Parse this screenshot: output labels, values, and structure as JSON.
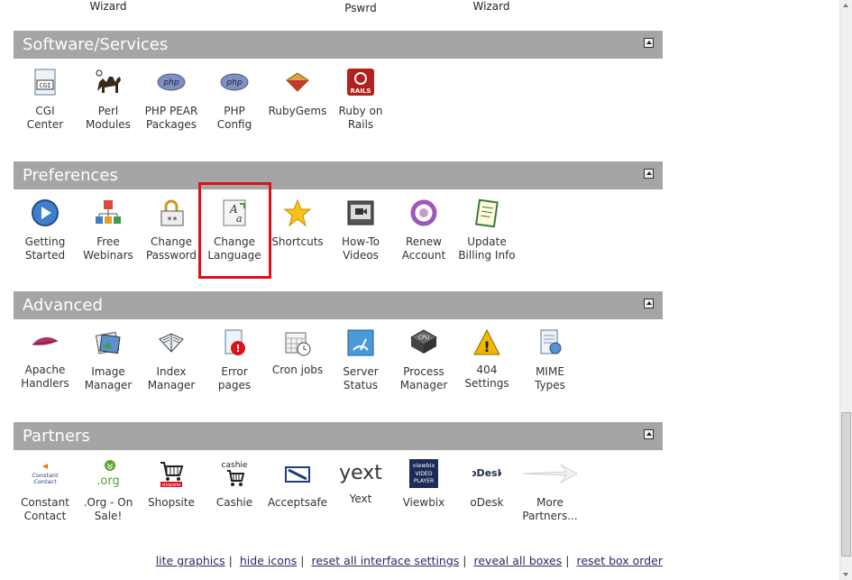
{
  "top_row": [
    "Wizard",
    "Pswrd",
    "Wizard"
  ],
  "sections": {
    "software": {
      "title": "Software/Services",
      "items": [
        {
          "label": "CGI\nCenter",
          "icon": "cgi-icon"
        },
        {
          "label": "Perl\nModules",
          "icon": "camel-icon"
        },
        {
          "label": "PHP PEAR\nPackages",
          "icon": "php-icon"
        },
        {
          "label": "PHP\nConfig",
          "icon": "php-icon"
        },
        {
          "label": "RubyGems",
          "icon": "ruby-gem-icon"
        },
        {
          "label": "Ruby on\nRails",
          "icon": "rails-icon"
        }
      ]
    },
    "preferences": {
      "title": "Preferences",
      "items": [
        {
          "label": "Getting\nStarted",
          "icon": "play-icon"
        },
        {
          "label": "Free\nWebinars",
          "icon": "webinar-icon"
        },
        {
          "label": "Change\nPassword",
          "icon": "password-lock-icon"
        },
        {
          "label": "Change\nLanguage",
          "icon": "language-icon"
        },
        {
          "label": "Shortcuts",
          "icon": "star-icon"
        },
        {
          "label": "How-To\nVideos",
          "icon": "video-icon"
        },
        {
          "label": "Renew\nAccount",
          "icon": "renew-icon"
        },
        {
          "label": "Update\nBilling Info",
          "icon": "billing-icon"
        }
      ]
    },
    "advanced": {
      "title": "Advanced",
      "items": [
        {
          "label": "Apache\nHandlers",
          "icon": "apache-feather-icon"
        },
        {
          "label": "Image\nManager",
          "icon": "image-icon"
        },
        {
          "label": "Index\nManager",
          "icon": "index-book-icon"
        },
        {
          "label": "Error\npages",
          "icon": "error-page-icon"
        },
        {
          "label": "Cron jobs",
          "icon": "calendar-clock-icon"
        },
        {
          "label": "Server\nStatus",
          "icon": "server-status-icon"
        },
        {
          "label": "Process\nManager",
          "icon": "cpu-icon"
        },
        {
          "label": "404\nSettings",
          "icon": "warning-icon"
        },
        {
          "label": "MIME\nTypes",
          "icon": "mime-icon"
        }
      ]
    },
    "partners": {
      "title": "Partners",
      "items": [
        {
          "label": "Constant\nContact",
          "icon": "constant-contact-logo-icon",
          "logo_text": "Constant Contact"
        },
        {
          "label": ".Org - On\nSale!",
          "icon": "org-logo-icon",
          "logo_text": ".org"
        },
        {
          "label": "Shopsite",
          "icon": "shopsite-cart-icon",
          "logo_text": "shopsite"
        },
        {
          "label": "Cashie",
          "icon": "cashie-cart-icon",
          "logo_text": "cashie"
        },
        {
          "label": "Acceptsafe",
          "icon": "acceptsafe-card-icon"
        },
        {
          "label": "Yext",
          "icon": "yext-logo-icon",
          "logo_text": "yext"
        },
        {
          "label": "Viewbix",
          "icon": "viewbix-logo-icon",
          "logo_text": "viewbix VIDEO PLAYER"
        },
        {
          "label": "oDesk",
          "icon": "odesk-logo-icon",
          "logo_text": "oDesk"
        },
        {
          "label": "More\nPartners...",
          "icon": "arrow-right-icon"
        }
      ]
    }
  },
  "footer": [
    "lite graphics",
    "hide icons",
    "reset all interface settings",
    "reveal all boxes",
    "reset box order"
  ],
  "footer_sep": "|",
  "highlight_color": "#d9121b",
  "header_color": "#a5a5a5"
}
